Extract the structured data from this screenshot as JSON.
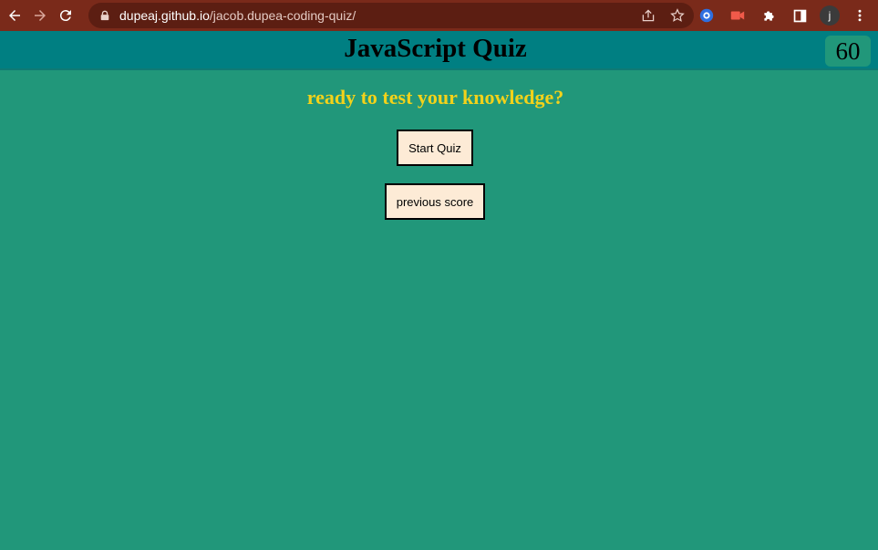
{
  "browser": {
    "url_host": "dupeaj.github.io",
    "url_path": "/jacob.dupea-coding-quiz/",
    "avatar_letter": "j",
    "colors": {
      "toolbar": "#7a2a1a",
      "omnibox": "#5c1e12"
    }
  },
  "header": {
    "title": "JavaScript Quiz",
    "timer": "60"
  },
  "main": {
    "subtitle": "ready to test your knowledge?",
    "start_label": "Start Quiz",
    "previous_label": "previous score"
  },
  "colors": {
    "page_bg": "#21977a",
    "header_bg": "#007f82",
    "subtitle": "#f3d21a",
    "button_bg": "#fdebd6"
  }
}
